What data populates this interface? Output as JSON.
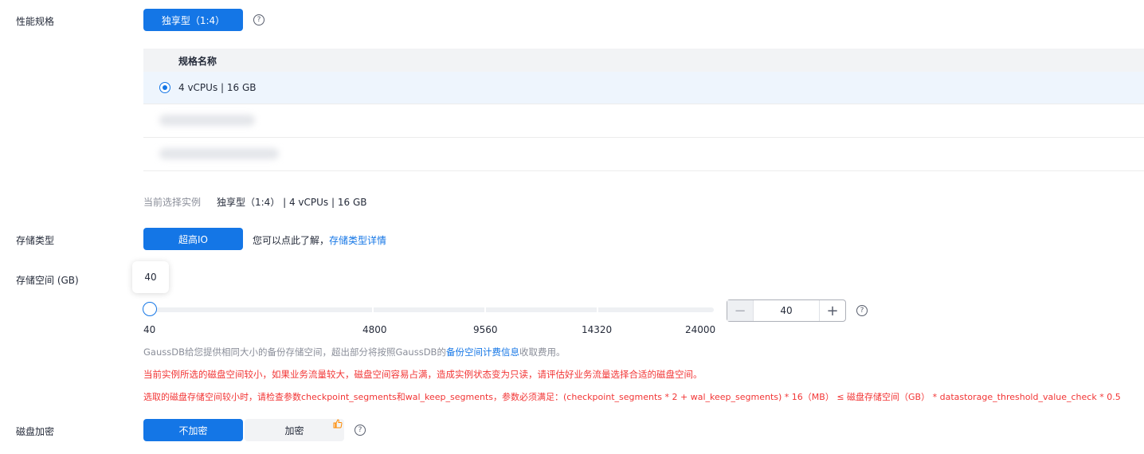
{
  "perf_spec": {
    "label": "性能规格",
    "type_button": "独享型（1:4）",
    "help_icon": "?"
  },
  "spec_table": {
    "header": "规格名称",
    "rows": [
      {
        "label": "4 vCPUs | 16 GB",
        "selected": true
      }
    ]
  },
  "current_selection": {
    "label": "当前选择实例",
    "value": "独享型（1:4） | 4 vCPUs | 16 GB"
  },
  "storage_type": {
    "label": "存储类型",
    "button": "超高IO",
    "hint": "您可以点此了解，",
    "link": "存储类型详情"
  },
  "storage_space": {
    "label": "存储空间 (GB)",
    "tooltip_value": "40",
    "slider_value": 40,
    "slider_min": 40,
    "slider_max": 24000,
    "tick_labels": [
      "40",
      "4800",
      "9560",
      "14320",
      "24000"
    ],
    "stepper_value": "40",
    "minus": "−",
    "plus": "+",
    "backup_note_prefix": "GaussDB给您提供相同大小的备份存储空间，超出部分将按照GaussDB的",
    "backup_note_link": "备份空间计费信息",
    "backup_note_suffix": "收取费用。",
    "warning_1": "当前实例所选的磁盘空间较小，如果业务流量较大，磁盘空间容易占满，造成实例状态变为只读，请评估好业务流量选择合适的磁盘空间。",
    "warning_2": "选取的磁盘存储空间较小时，请检查参数checkpoint_segments和wal_keep_segments，参数必须满足：(checkpoint_segments * 2 + wal_keep_segments) * 16（MB） ≤ 磁盘存储空间（GB） * datastorage_threshold_value_check * 0.5"
  },
  "disk_encryption": {
    "label": "磁盘加密",
    "option_off": "不加密",
    "option_on": "加密",
    "badge_icon": "thumbs-up"
  },
  "colors": {
    "primary": "#1476e6",
    "warning": "#f23535",
    "badge": "#ff8a00"
  }
}
